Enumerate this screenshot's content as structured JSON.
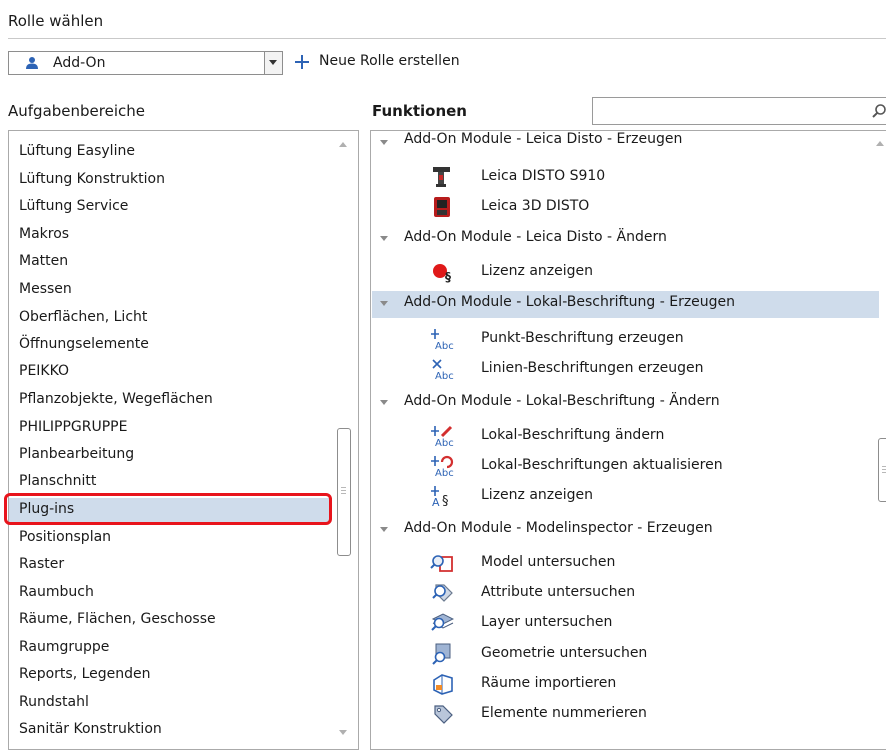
{
  "header": {
    "title": "Rolle wählen"
  },
  "role": {
    "selected": "Add-On",
    "new_role_label": "Neue Rolle erstellen"
  },
  "left_panel": {
    "title": "Aufgabenbereiche",
    "items": [
      "Lüftung Easyline",
      "Lüftung Konstruktion",
      "Lüftung Service",
      "Makros",
      "Matten",
      "Messen",
      "Oberflächen, Licht",
      "Öffnungselemente",
      "PEIKKO",
      "Pflanzobjekte, Wegeflächen",
      "PHILIPPGRUPPE",
      "Planbearbeitung",
      "Planschnitt",
      "Plug-ins",
      "Positionsplan",
      "Raster",
      "Raumbuch",
      "Räume, Flächen, Geschosse",
      "Raumgruppe",
      "Reports, Legenden",
      "Rundstahl",
      "Sanitär Konstruktion"
    ],
    "selected_index": 13
  },
  "right_panel": {
    "title": "Funktionen",
    "search": {
      "value": "",
      "placeholder": ""
    },
    "groups": [
      {
        "label": "Add-On Module - Leica Disto - Erzeugen",
        "items": [
          {
            "label": "Leica DISTO S910",
            "icon": "disto-s910-icon"
          },
          {
            "label": "Leica 3D DISTO",
            "icon": "disto-3d-icon"
          }
        ]
      },
      {
        "label": "Add-On Module - Leica Disto - Ändern",
        "items": [
          {
            "label": "Lizenz anzeigen",
            "icon": "license-red-icon"
          }
        ]
      },
      {
        "label": "Add-On Module - Lokal-Beschriftung - Erzeugen",
        "selected": true,
        "items": [
          {
            "label": "Punkt-Beschriftung erzeugen",
            "icon": "point-label-icon"
          },
          {
            "label": "Linien-Beschriftungen erzeugen",
            "icon": "line-label-icon"
          }
        ]
      },
      {
        "label": "Add-On Module - Lokal-Beschriftung - Ändern",
        "items": [
          {
            "label": "Lokal-Beschriftung ändern",
            "icon": "label-edit-icon"
          },
          {
            "label": "Lokal-Beschriftungen aktualisieren",
            "icon": "label-refresh-icon"
          },
          {
            "label": "Lizenz anzeigen",
            "icon": "license-label-icon"
          }
        ]
      },
      {
        "label": "Add-On Module - Modelinspector - Erzeugen",
        "items": [
          {
            "label": "Model untersuchen",
            "icon": "model-inspect-icon"
          },
          {
            "label": "Attribute untersuchen",
            "icon": "attribute-inspect-icon"
          },
          {
            "label": "Layer untersuchen",
            "icon": "layer-inspect-icon"
          },
          {
            "label": "Geometrie untersuchen",
            "icon": "geometry-inspect-icon"
          },
          {
            "label": "Räume importieren",
            "icon": "rooms-import-icon"
          },
          {
            "label": "Elemente nummerieren",
            "icon": "numbering-icon"
          }
        ]
      }
    ]
  },
  "colors": {
    "selection": "#cfdceb",
    "highlight": "#e8141c",
    "accent_blue": "#2d63b5"
  }
}
